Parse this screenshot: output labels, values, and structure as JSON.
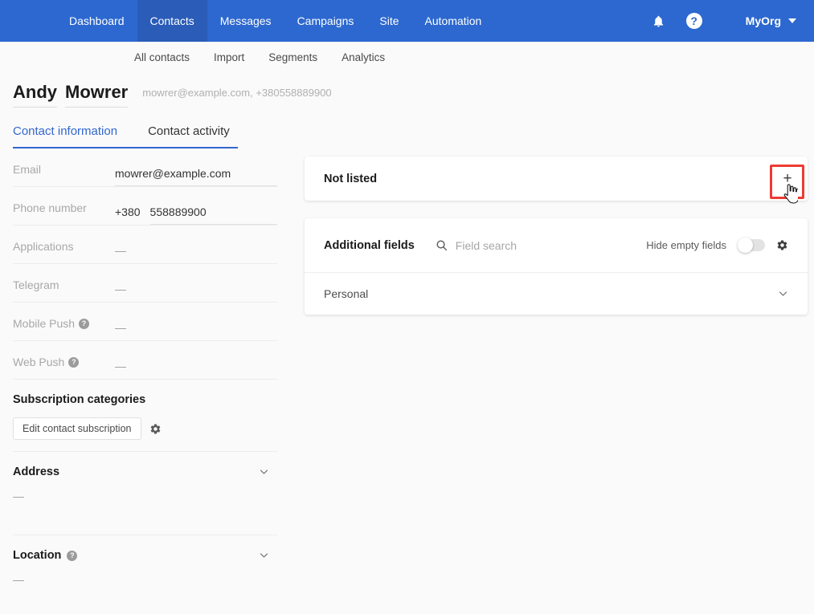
{
  "topnav": {
    "items": [
      {
        "label": "Dashboard",
        "active": false
      },
      {
        "label": "Contacts",
        "active": true
      },
      {
        "label": "Messages",
        "active": false
      },
      {
        "label": "Campaigns",
        "active": false
      },
      {
        "label": "Site",
        "active": false
      },
      {
        "label": "Automation",
        "active": false
      }
    ],
    "notifications_icon": "bell-icon",
    "help_icon": "help-circle-icon",
    "org_label": "MyOrg",
    "brand_color": "#2c68cf",
    "active_tab_color": "#2a5cb8"
  },
  "subnav": {
    "items": [
      {
        "label": "All contacts"
      },
      {
        "label": "Import"
      },
      {
        "label": "Segments"
      },
      {
        "label": "Analytics"
      }
    ]
  },
  "contact": {
    "first_name": "Andy",
    "last_name": "Mowrer",
    "summary": "mowrer@example.com, +380558889900"
  },
  "tabs": [
    {
      "label": "Contact information",
      "active": true
    },
    {
      "label": "Contact activity",
      "active": false
    }
  ],
  "left_panel": {
    "fields": [
      {
        "label": "Email",
        "value": "mowrer@example.com",
        "type": "input"
      },
      {
        "label": "Phone number",
        "code": "+380",
        "value": "558889900",
        "type": "phone"
      },
      {
        "label": "Applications",
        "value": "—",
        "type": "static"
      },
      {
        "label": "Telegram",
        "value": "—",
        "type": "static"
      },
      {
        "label": "Mobile Push",
        "value": "—",
        "type": "static",
        "help": true
      },
      {
        "label": "Web Push",
        "value": "—",
        "type": "static",
        "help": true
      }
    ],
    "subscription": {
      "title": "Subscription categories",
      "button_label": "Edit contact subscription",
      "settings_icon": "gear-icon"
    },
    "address": {
      "title": "Address",
      "value": "—",
      "chevron_icon": "chevron-down-icon"
    },
    "location": {
      "title": "Location",
      "value": "—",
      "help_icon": "help-circle-icon",
      "chevron_icon": "chevron-down-icon"
    }
  },
  "right_panel": {
    "not_listed": {
      "title": "Not listed",
      "add_label": "+",
      "add_icon": "plus-icon",
      "highlight_color": "#ee3b33",
      "cursor_icon": "pointer-hand-cursor"
    },
    "additional_fields": {
      "title": "Additional fields",
      "search_placeholder": "Field search",
      "search_icon": "search-icon",
      "hide_empty_label": "Hide empty fields",
      "toggle_state": "off",
      "settings_icon": "gear-icon",
      "groups": [
        {
          "label": "Personal",
          "chevron_icon": "chevron-down-icon"
        }
      ]
    }
  }
}
